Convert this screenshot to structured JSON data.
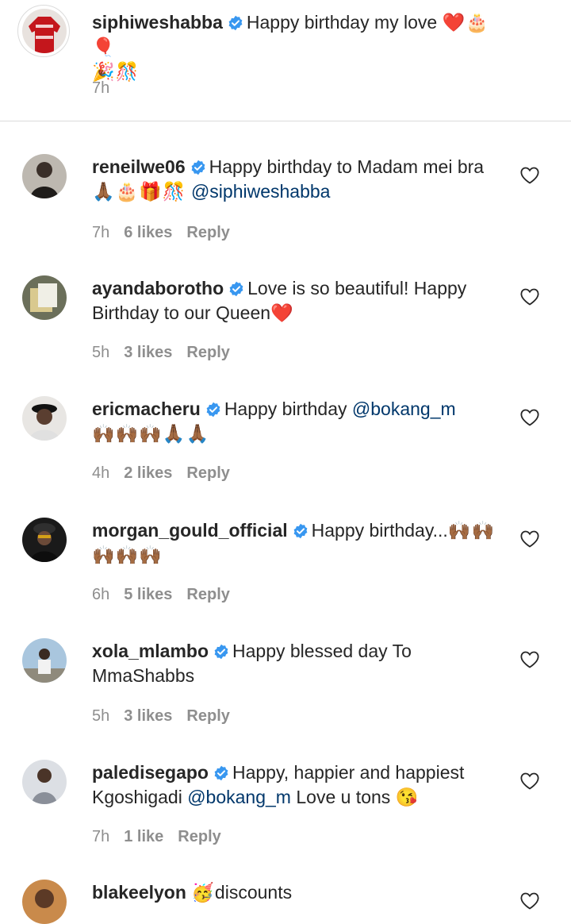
{
  "caption": {
    "username": "siphiweshabba",
    "text": "Happy birthday my love",
    "emojis_line1": "❤️🎂🎈",
    "emojis_line2": "🎉🎊",
    "time": "7h"
  },
  "comments": [
    {
      "username": "reneilwe06",
      "text": "Happy birthday to Madam mei bra",
      "emojis": "🙏🏾🎂🎁🎊",
      "mention": "@siphiweshabba",
      "time": "7h",
      "likes": "6 likes",
      "reply": "Reply"
    },
    {
      "username": "ayandaborotho",
      "text": "Love is so beautiful! Happy Birthday to our Queen",
      "emojis": "❤️",
      "time": "5h",
      "likes": "3 likes",
      "reply": "Reply"
    },
    {
      "username": "ericmacheru",
      "text": "Happy birthday",
      "mention": "@bokang_m",
      "emojis": "🙌🏾🙌🏾🙌🏾🙏🏾🙏🏾",
      "time": "4h",
      "likes": "2 likes",
      "reply": "Reply"
    },
    {
      "username": "morgan_gould_official",
      "text": "Happy birthday...",
      "emojis": "🙌🏾🙌🏾🙌🏾🙌🏾🙌🏾",
      "time": "6h",
      "likes": "5 likes",
      "reply": "Reply"
    },
    {
      "username": "xola_mlambo",
      "text": "Happy blessed day To MmaShabbs",
      "time": "5h",
      "likes": "3 likes",
      "reply": "Reply"
    },
    {
      "username": "paledisegapo",
      "text": "Happy, happier and happiest Kgoshigadi",
      "mention": "@bokang_m",
      "text2": "Love u tons",
      "emojis": "😘",
      "time": "7h",
      "likes": "1 like",
      "reply": "Reply"
    },
    {
      "username": "blakeelyon",
      "emojis": "🥳",
      "text": "discounts"
    }
  ],
  "colors": {
    "verified": "#3897f0",
    "mention": "#00376b",
    "meta": "#8e8e8e",
    "divider": "#dbdbdb"
  }
}
